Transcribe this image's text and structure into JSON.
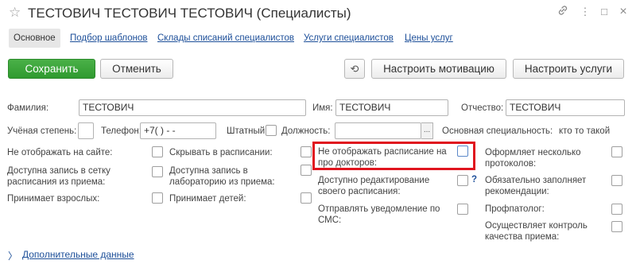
{
  "window": {
    "title": "ТЕСТОВИЧ ТЕСТОВИЧ ТЕСТОВИЧ (Специалисты)",
    "star_icon": "☆",
    "link_icon": "🔗",
    "menu_icon": "⋮",
    "maximize_icon": "□",
    "close_icon": "×"
  },
  "tabs": [
    {
      "label": "Основное"
    },
    {
      "label": "Подбор шаблонов"
    },
    {
      "label": "Склады списаний специалистов"
    },
    {
      "label": "Услуги специалистов"
    },
    {
      "label": "Цены услуг"
    }
  ],
  "toolbar": {
    "save_label": "Сохранить",
    "cancel_label": "Отменить",
    "history_icon": "⟲",
    "motivation_label": "Настроить мотивацию",
    "services_label": "Настроить услуги"
  },
  "form": {
    "surname_label": "Фамилия:",
    "surname_value": "ТЕСТОВИЧ",
    "name_label": "Имя:",
    "name_value": "ТЕСТОВИЧ",
    "patronymic_label": "Отчество:",
    "patronymic_value": "ТЕСТОВИЧ",
    "degree_label": "Учёная степень:",
    "phone_label": "Телефон:",
    "phone_value": "+7(   )   -   -",
    "staff_label": "Штатный:",
    "position_label": "Должность:",
    "position_dots": "...",
    "specialty_label": "Основная специальность:",
    "specialty_value": "кто то такой"
  },
  "checkboxes": {
    "hide_on_site": "Не отображать на сайте:",
    "hide_in_schedule": "Скрывать в расписании:",
    "hide_schedule_for_doctors": "Не отображать расписание на про докторов:",
    "multiple_protocols": "Оформляет несколько протоколов:",
    "booking_from_reception": "Доступна запись в сетку расписания из приема:",
    "booking_to_lab": "Доступна запись в лабораторию из приема:",
    "edit_own_schedule": "Доступно редактирование своего расписания:",
    "help_mark": "?",
    "must_fill_recommendations": "Обязательно заполняет рекомендации:",
    "accepts_adults": "Принимает взрослых:",
    "accepts_children": "Принимает детей:",
    "send_sms": "Отправлять уведомление по СМС:",
    "occupational_pathologist": "Профпатолог:",
    "quality_control": "Осуществляет контроль качества приема:"
  },
  "more": {
    "chevron": "〉",
    "label": "Дополнительные данные"
  }
}
